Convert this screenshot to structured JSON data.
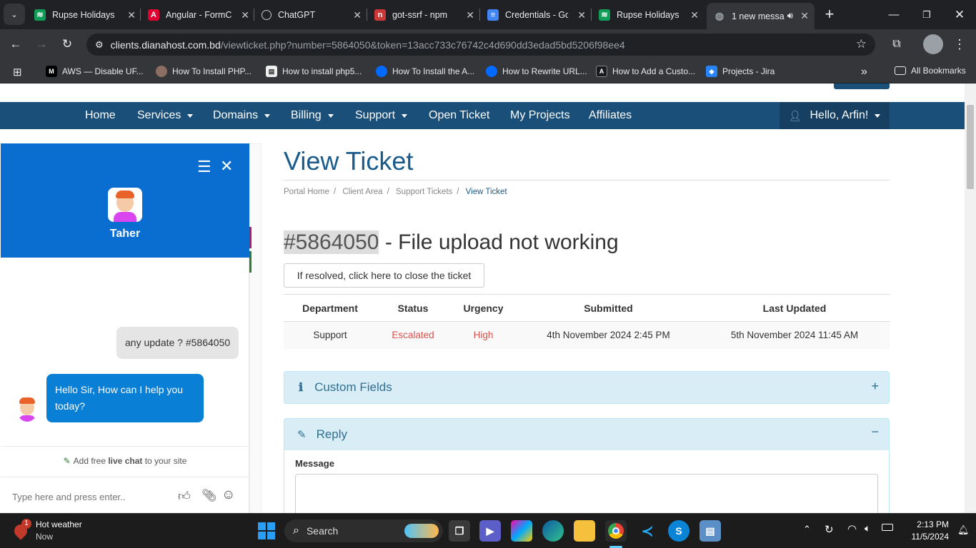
{
  "browser": {
    "tabs": [
      {
        "title": "Rupse Holidays",
        "icon": "rupse-icon",
        "color": "#0f9d58",
        "active": false
      },
      {
        "title": "Angular - FormC",
        "icon": "angular-icon",
        "color": "#dd0031",
        "active": false
      },
      {
        "title": "ChatGPT",
        "icon": "chatgpt-icon",
        "color": "#5f6368",
        "active": false
      },
      {
        "title": "got-ssrf - npm",
        "icon": "npm-icon",
        "color": "#cb3837",
        "active": false
      },
      {
        "title": "Credentials - Go",
        "icon": "docs-icon",
        "color": "#4285f4",
        "active": false
      },
      {
        "title": "Rupse Holidays",
        "icon": "rupse-icon",
        "color": "#0f9d58",
        "active": false
      },
      {
        "title": "1 new messa",
        "icon": "globe-icon",
        "color": "#9aa0a6",
        "active": true
      }
    ],
    "url_host": "clients.dianahost.com.bd",
    "url_path": "/viewticket.php?number=5864050&token=13acc733c76742c4d690dd3edad5bd5206f98ee4",
    "bookmarks": [
      {
        "label": "AWS — Disable UF...",
        "icon": "medium-icon",
        "color": "#000000"
      },
      {
        "label": "How To Install PHP...",
        "icon": "site-icon",
        "color": "#8d6e63"
      },
      {
        "label": "How to install php5...",
        "icon": "doc-icon",
        "color": "#eeeeee"
      },
      {
        "label": "How To Install the A...",
        "icon": "do-icon",
        "color": "#0069ff"
      },
      {
        "label": "How to Rewrite URL...",
        "icon": "do-icon",
        "color": "#0069ff"
      },
      {
        "label": "How to Add a Custo...",
        "icon": "astro-icon",
        "color": "#17191e"
      },
      {
        "label": "Projects - Jira",
        "icon": "jira-icon",
        "color": "#2684ff"
      }
    ],
    "all_bookmarks": "All Bookmarks"
  },
  "nav": {
    "items": [
      "Home",
      "Services",
      "Domains",
      "Billing",
      "Support",
      "Open Ticket",
      "My Projects",
      "Affiliates"
    ],
    "dropdown": [
      false,
      true,
      true,
      true,
      true,
      false,
      false,
      false
    ],
    "user": "Hello, Arfin!"
  },
  "page": {
    "title": "View Ticket",
    "breadcrumbs": [
      "Portal Home",
      "Client Area",
      "Support Tickets",
      "View Ticket"
    ],
    "ticket_number": "#5864050",
    "ticket_subject": " - File upload not working",
    "close_button": "If resolved, click here to close the ticket",
    "table": {
      "headers": [
        "Department",
        "Status",
        "Urgency",
        "Submitted",
        "Last Updated"
      ],
      "row": [
        "Support",
        "Escalated",
        "High",
        "4th November 2024 2:45 PM",
        "5th November 2024 11:45 AM"
      ]
    },
    "custom_fields": "Custom Fields",
    "reply": "Reply",
    "message_label": "Message"
  },
  "chat": {
    "agent_name": "Taher",
    "messages": [
      {
        "from": "user",
        "text": "any update ? #5864050"
      },
      {
        "from": "agent",
        "text": "Hello Sir, How can I help you today?"
      }
    ],
    "promo_prefix": "Add free ",
    "promo_bold": "live chat",
    "promo_suffix": " to your site",
    "input_placeholder": "Type here and press enter.."
  },
  "taskbar": {
    "weather_title": "Hot weather",
    "weather_sub": "Now",
    "weather_badge": "1",
    "search": "Search",
    "time": "2:13 PM",
    "date": "11/5/2024"
  }
}
